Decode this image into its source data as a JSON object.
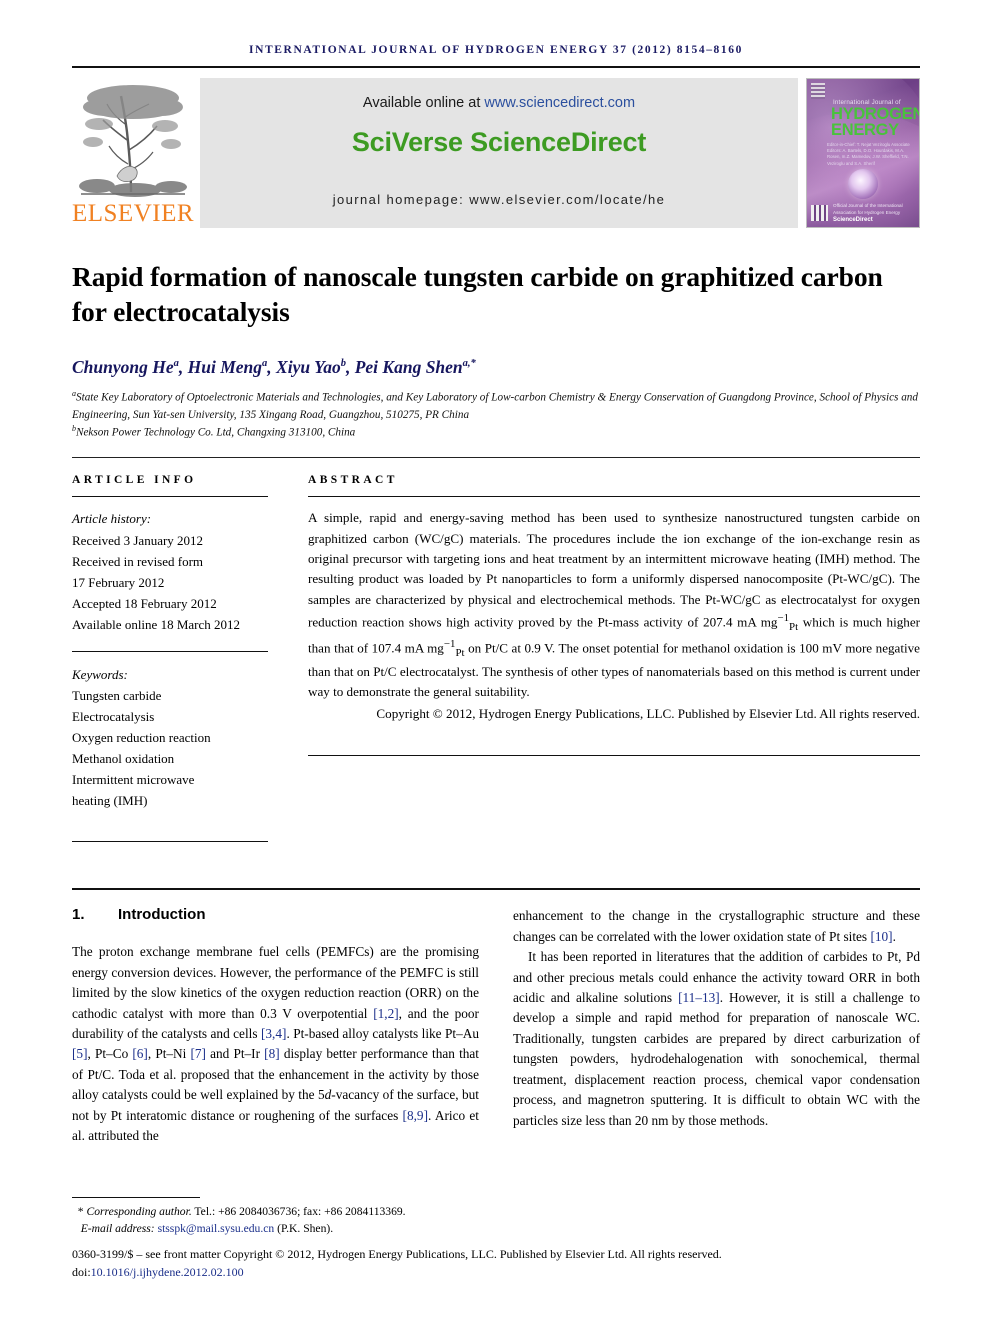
{
  "running_head": "INTERNATIONAL JOURNAL OF HYDROGEN ENERGY 37 (2012) 8154–8160",
  "masthead": {
    "publisher_name": "ELSEVIER",
    "available_prefix": "Available online at ",
    "available_url": "www.sciencedirect.com",
    "sciverse_logo": "SciVerse ScienceDirect",
    "homepage": "journal homepage: www.elsevier.com/locate/he",
    "cover": {
      "line_small": "International Journal of",
      "line_h": "HYDROGEN",
      "line_e": "ENERGY",
      "editors": "Editor-in-Chief:  T. Nejat Veziroglu\nAssociate Editors:  A. Bartels, D.O. Hourdakis, M.A. Rosen,\nm.Z. Mamedov, J.W. Sheffield,\nT.N. Veziroglu and S.A. Sherif",
      "footer_note": "Official Journal of the International Association for Hydrogen Energy",
      "sd_label": "ScienceDirect"
    }
  },
  "article": {
    "title": "Rapid formation of nanoscale tungsten carbide on graphitized carbon for electrocatalysis",
    "authors_html": "Chunyong He<sup>a</sup>, Hui Meng<sup>a</sup>, Xiyu Yao<sup>b</sup>, Pei Kang Shen<sup>a,*</sup>",
    "affiliation_a": "State Key Laboratory of Optoelectronic Materials and Technologies, and Key Laboratory of Low-carbon Chemistry & Energy Conservation of Guangdong Province, School of Physics and Engineering, Sun Yat-sen University, 135 Xingang Road, Guangzhou, 510275, PR China",
    "affiliation_b": "Nekson Power Technology Co. Ltd, Changxing 313100, China"
  },
  "article_info": {
    "heading": "ARTICLE INFO",
    "history_label": "Article history:",
    "history": [
      "Received 3 January 2012",
      "Received in revised form",
      "17 February 2012",
      "Accepted 18 February 2012",
      "Available online 18 March 2012"
    ],
    "keywords_label": "Keywords:",
    "keywords": [
      "Tungsten carbide",
      "Electrocatalysis",
      "Oxygen reduction reaction",
      "Methanol oxidation",
      "Intermittent microwave",
      "heating (IMH)"
    ]
  },
  "abstract": {
    "heading": "ABSTRACT",
    "body": "A simple, rapid and energy-saving method has been used to synthesize nanostructured tungsten carbide on graphitized carbon (WC/gC) materials. The procedures include the ion exchange of the ion-exchange resin as original precursor with targeting ions and heat treatment by an intermittent microwave heating (IMH) method. The resulting product was loaded by Pt nanoparticles to form a uniformly dispersed nanocomposite (Pt-WC/gC). The samples are characterized by physical and electrochemical methods. The Pt-WC/gC as electrocatalyst for oxygen reduction reaction shows high activity proved by the Pt-mass activity of 207.4 mA mg⁻¹Pt which is much higher than that of 107.4 mA mg⁻¹Pt on Pt/C at 0.9 V. The onset potential for methanol oxidation is 100 mV more negative than that on Pt/C electrocatalyst. The synthesis of other types of nanomaterials based on this method is current under way to demonstrate the general suitability.",
    "copyright": "Copyright © 2012, Hydrogen Energy Publications, LLC. Published by Elsevier Ltd. All rights reserved."
  },
  "introduction": {
    "number": "1.",
    "heading": "Introduction",
    "p1": "The proton exchange membrane fuel cells (PEMFCs) are the promising energy conversion devices. However, the performance of the PEMFC is still limited by the slow kinetics of the oxygen reduction reaction (ORR) on the cathodic catalyst with more than 0.3 V overpotential [1,2], and the poor durability of the catalysts and cells [3,4]. Pt-based alloy catalysts like Pt–Au [5], Pt–Co [6], Pt–Ni [7] and Pt–Ir [8] display better performance than that of Pt/C. Toda et al. proposed that the enhancement in the activity by those alloy catalysts could be well explained by the 5d-vacancy of the surface, but not by Pt interatomic distance or roughening of the surfaces [8,9]. Arico et al. attributed the enhancement to the change in the crystallographic structure and these changes can be correlated with the lower oxidation state of Pt sites [10].",
    "p2": "It has been reported in literatures that the addition of carbides to Pt, Pd and other precious metals could enhance the activity toward ORR in both acidic and alkaline solutions [11–13]. However, it is still a challenge to develop a simple and rapid method for preparation of nanoscale WC. Traditionally, tungsten carbides are prepared by direct carburization of tungsten powders, hydrodehalogenation with sonochemical, thermal treatment, displacement reaction process, chemical vapor condensation process, and magnetron sputtering. It is difficult to obtain WC with the particles size less than 20 nm by those methods."
  },
  "footnotes": {
    "corresponding_label": "Corresponding author.",
    "corresponding_rest": " Tel.: +86 2084036736; fax: +86 2084113369.",
    "email_label": "E-mail address: ",
    "email": "stsspk@mail.sysu.edu.cn",
    "email_suffix": " (P.K. Shen).",
    "issn_line": "0360-3199/$ – see front matter Copyright © 2012, Hydrogen Energy Publications, LLC. Published by Elsevier Ltd. All rights reserved.",
    "doi_prefix": "doi:",
    "doi": "10.1016/j.ijhydene.2012.02.100"
  },
  "colors": {
    "running_head": "#1b1b64",
    "elsevier_orange": "#F08122",
    "sciverse_green": "#3d9b22",
    "link_blue": "#2b4f9e",
    "ref_blue": "#1b2f8a",
    "author_navy": "#16165e",
    "banner_grey": "#e4e4e4"
  }
}
